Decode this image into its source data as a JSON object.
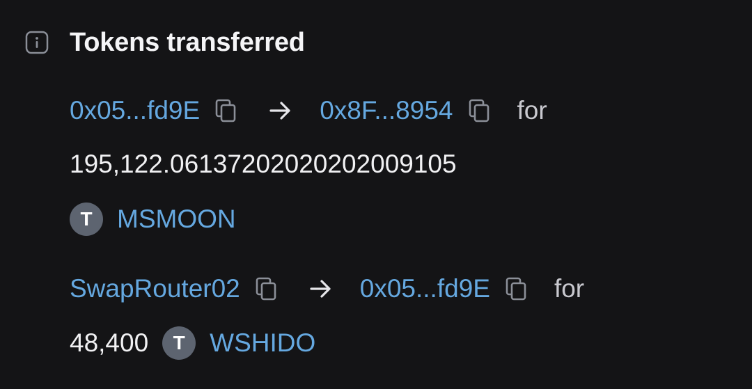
{
  "title": "Tokens transferred",
  "transfers": [
    {
      "from": "0x05...fd9E",
      "to": "0x8F...8954",
      "for_label": "for",
      "amount": "195,122.06137202020202009105",
      "token_avatar": "T",
      "token_symbol": "MSMOON"
    },
    {
      "from": "SwapRouter02",
      "to": "0x05...fd9E",
      "for_label": "for",
      "amount": "48,400",
      "token_avatar": "T",
      "token_symbol": "WSHIDO"
    }
  ],
  "icons": {
    "info": "info-icon",
    "copy": "copy-icon",
    "arrow": "arrow-right-icon"
  },
  "colors": {
    "background": "#141416",
    "link": "#65a8e0",
    "text": "#f1f1f3",
    "avatar": "#5d6470"
  }
}
